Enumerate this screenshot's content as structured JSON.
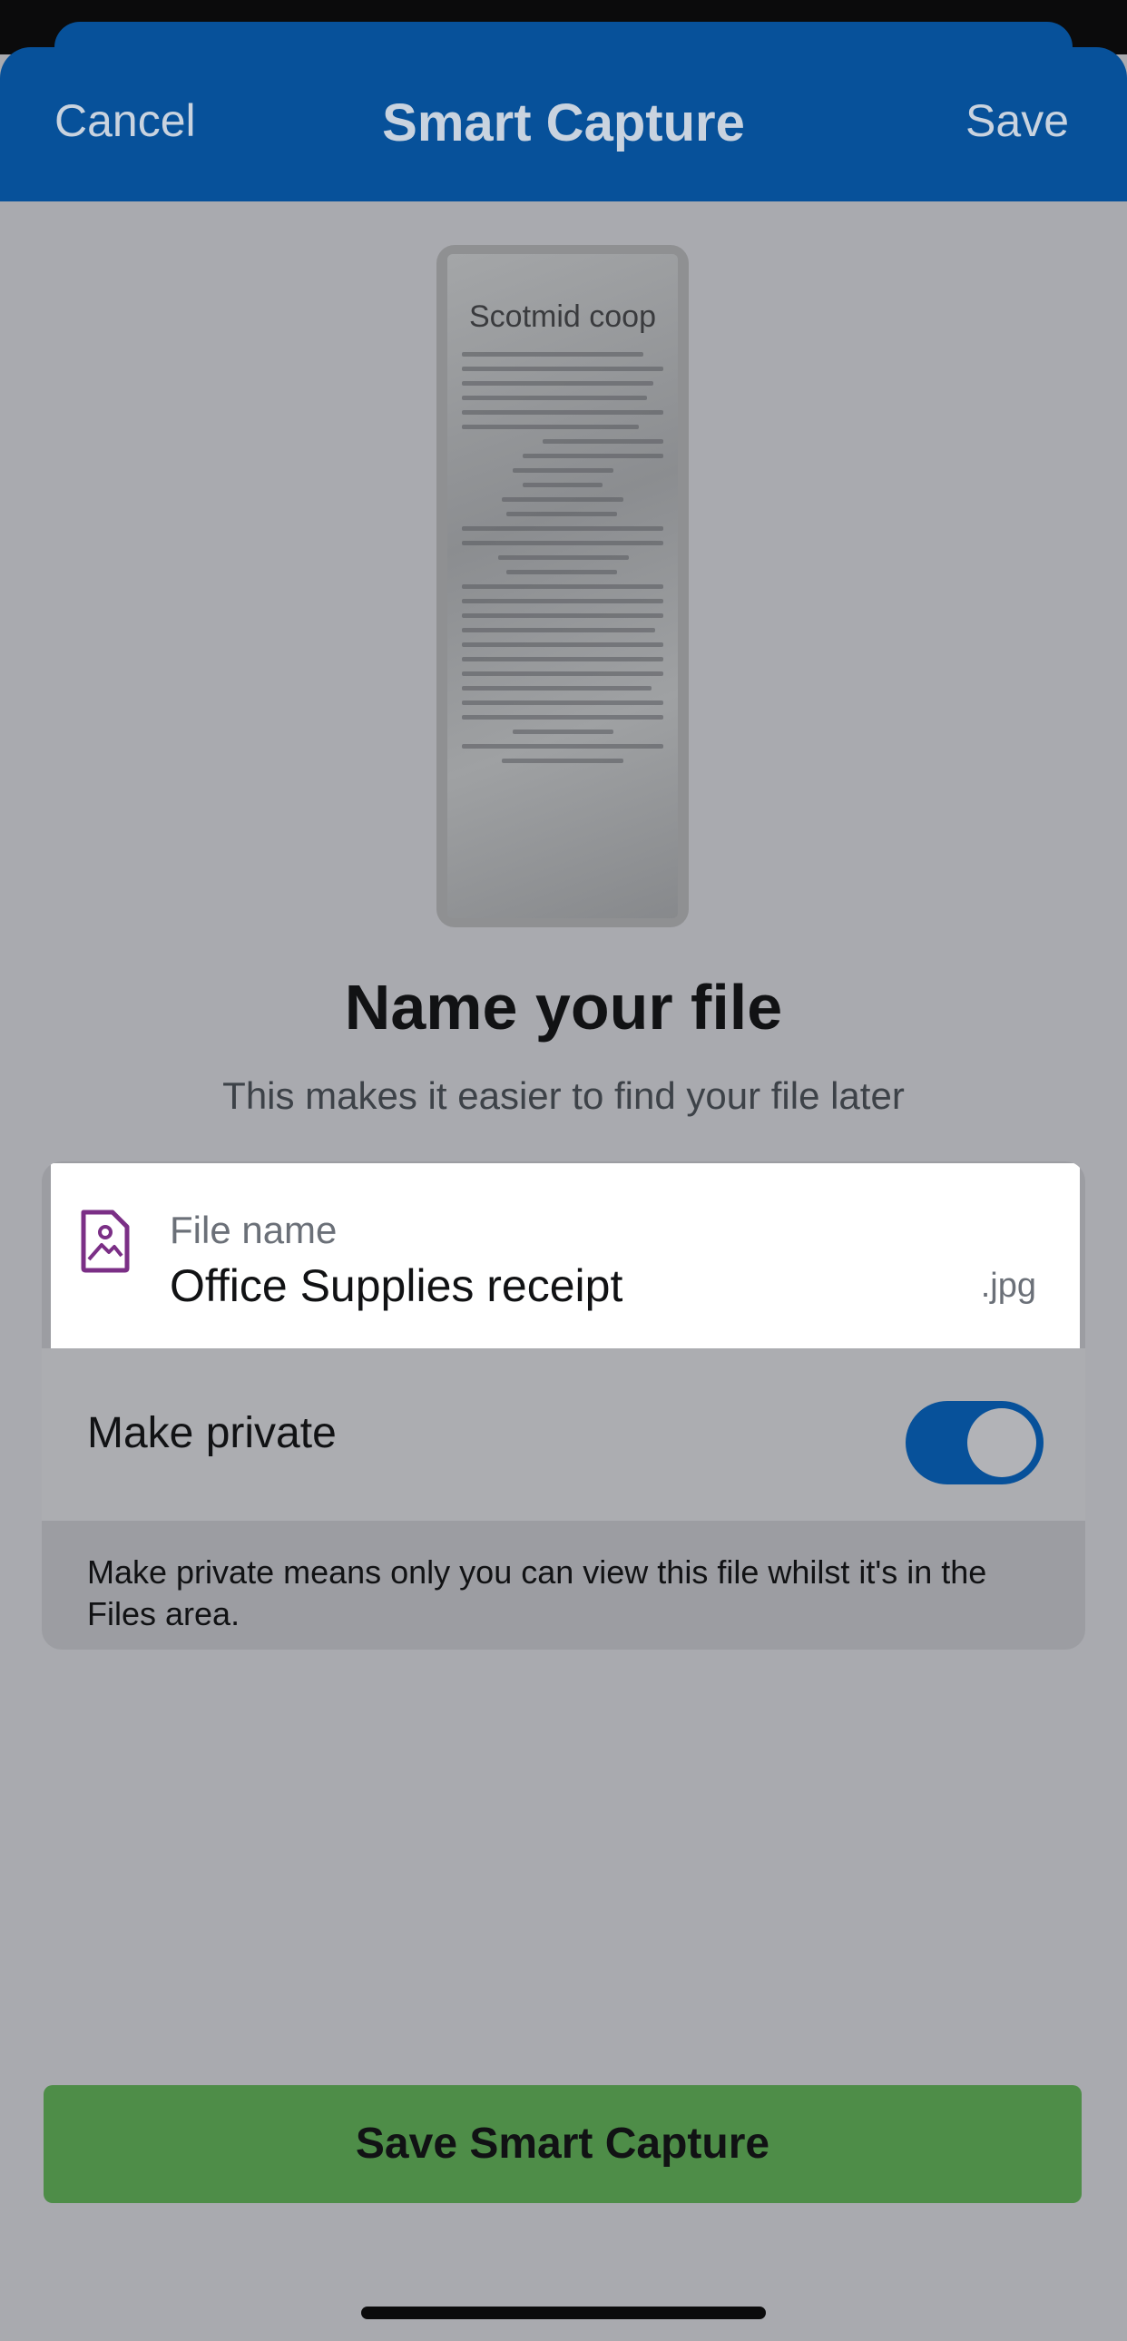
{
  "nav": {
    "cancel_label": "Cancel",
    "title": "Smart Capture",
    "save_label": "Save"
  },
  "receipt_preview": {
    "brand": "Scotmid coop"
  },
  "heading": "Name your file",
  "subheading": "This makes it easier to find your file later",
  "file": {
    "label": "File name",
    "value": "Office Supplies receipt",
    "extension": ".jpg",
    "icon": "image-file-icon"
  },
  "private": {
    "label": "Make private",
    "enabled": true,
    "note": "Make private means only you can view this file whilst it's in the Files area."
  },
  "save_button_label": "Save Smart Capture",
  "colors": {
    "nav": "#07519a",
    "toggle_on": "#07519a",
    "save_button": "#4e8d48",
    "file_icon": "#7b2f86"
  }
}
